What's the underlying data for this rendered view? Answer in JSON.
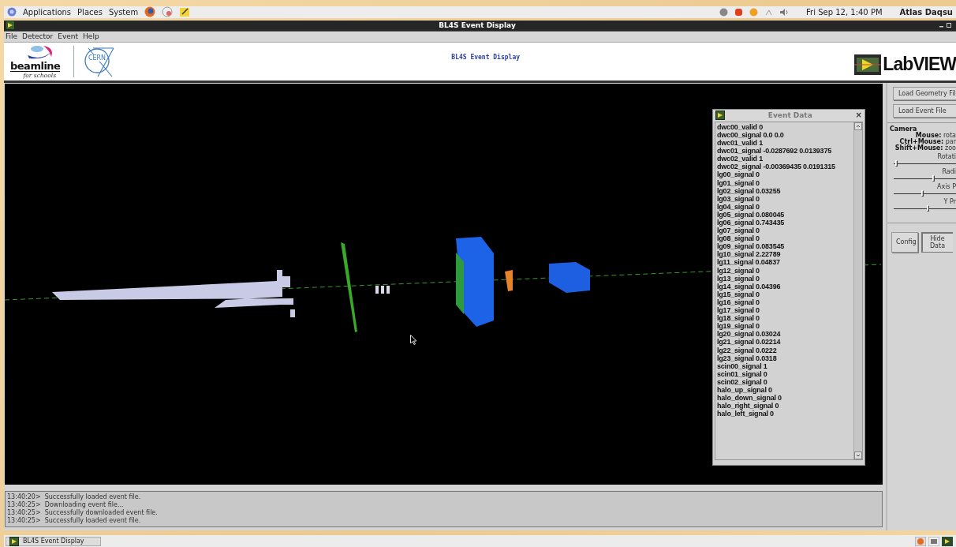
{
  "top_panel": {
    "menus": [
      "Applications",
      "Places",
      "System"
    ],
    "clock": "Fri Sep 12,  1:40 PM",
    "user": "Atlas Daqsu"
  },
  "window": {
    "title": "BL4S Event Display",
    "menus": [
      "File",
      "Detector",
      "Event",
      "Help"
    ]
  },
  "banner": {
    "logo_text": "beamline",
    "logo_subtext": "for schools",
    "cern_text": "CERN",
    "title": "BL4S Event Display",
    "brand": "LabVIEW"
  },
  "event_data": {
    "title": "Event Data",
    "close": "×",
    "lines": [
      "dwc00_valid 0",
      "dwc00_signal 0.0 0.0",
      "dwc01_valid 1",
      "dwc01_signal -0.0287692 0.0139375",
      "dwc02_valid 1",
      "dwc02_signal -0.00369435 0.0191315",
      "lg00_signal 0",
      "lg01_signal 0",
      "lg02_signal 0.03255",
      "lg03_signal 0",
      "lg04_signal 0",
      "lg05_signal 0.080045",
      "lg06_signal 0.743435",
      "lg07_signal 0",
      "lg08_signal 0",
      "lg09_signal 0.083545",
      "lg10_signal 2.22789",
      "lg11_signal 0.04837",
      "lg12_signal 0",
      "lg13_signal 0",
      "lg14_signal 0.04396",
      "lg15_signal 0",
      "lg16_signal 0",
      "lg17_signal 0",
      "lg18_signal 0",
      "lg19_signal 0",
      "lg20_signal 0.03024",
      "lg21_signal 0.02214",
      "lg22_signal 0.0222",
      "lg23_signal 0.0318",
      "scin00_signal 1",
      "scin01_signal 0",
      "scin02_signal 0",
      "halo_up_signal 0",
      "halo_down_signal 0",
      "halo_right_signal 0",
      "halo_left_signal 0"
    ]
  },
  "controls": {
    "buttons": [
      "Load Geometry Fil",
      "Load Event File"
    ],
    "camera": {
      "title": "Camera",
      "hints": [
        {
          "key": "Mouse:",
          "value": "rota"
        },
        {
          "key": "Ctrl+Mouse:",
          "value": "par"
        },
        {
          "key": "Shift+Mouse:",
          "value": "zoo"
        }
      ],
      "sliders": [
        {
          "label": "Rotati",
          "level": 0.02
        },
        {
          "label": "Radi",
          "level": 0.62
        },
        {
          "label": "Axis P",
          "level": 0.44
        },
        {
          "label": "Y Pr",
          "level": 0.53
        }
      ]
    },
    "bottom_buttons": [
      {
        "label": "Config",
        "pressed": false
      },
      {
        "label": "Hide Data",
        "pressed": true
      }
    ]
  },
  "log": [
    "13:40:20>  Successfully loaded event file.",
    "13:40:25>  Downloading event file...",
    "13:40:25>  Successfully downloaded event file.",
    "13:40:25>  Successfully loaded event file."
  ],
  "taskbar": {
    "item": "BL4S Event Display"
  }
}
